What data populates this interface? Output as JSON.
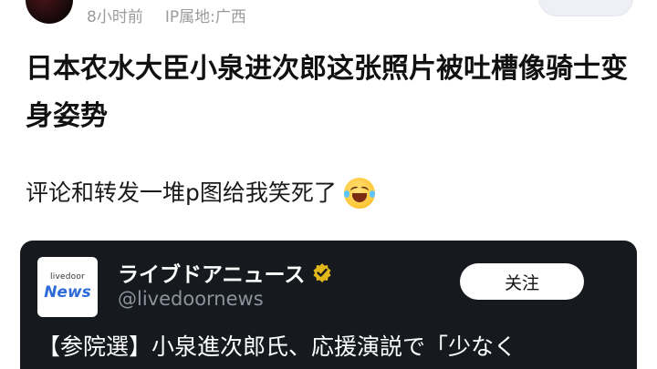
{
  "post": {
    "time_ago": "8小时前",
    "ip_location": "IP属地:广西",
    "title": "日本农水大臣小泉进次郎这张照片被吐槽像骑士变身姿势",
    "body": "评论和转发一堆p图给我笑死了"
  },
  "embedded_tweet": {
    "logo_small": "livedoor",
    "logo_big": "News",
    "account_name": "ライブドアニュース",
    "handle": "@livedoornews",
    "follow_label": "关注",
    "text": "【参院選】小泉進次郎氏、応援演説で「少なく"
  },
  "icons": {
    "emoji": "grinning-squinting-laughing-emoji",
    "verified": "verified-badge-icon"
  },
  "colors": {
    "follow_text": "#3a63d8",
    "card_bg": "#16191e",
    "verified_gold": "#e2b719"
  }
}
